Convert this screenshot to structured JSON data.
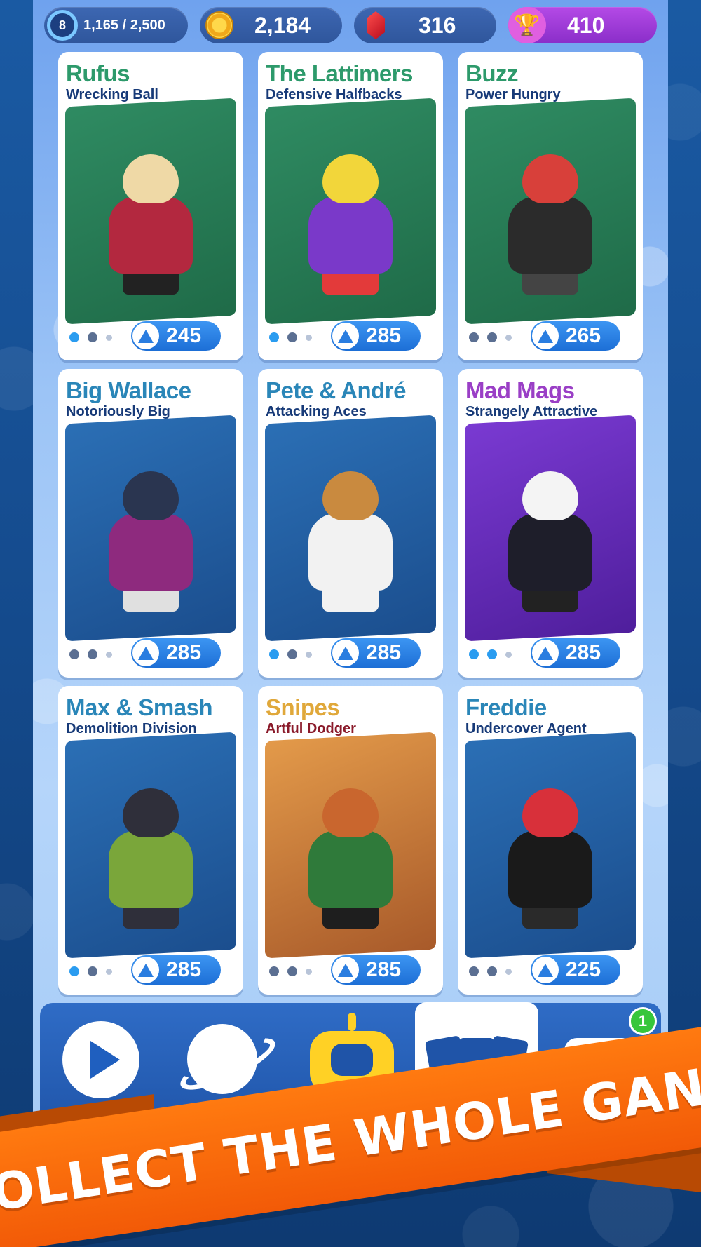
{
  "topbar": {
    "level": "8",
    "xp": "1,165 / 2,500",
    "coins": "2,184",
    "gems": "316",
    "trophies": "410",
    "icons": [
      "xp-ring-icon",
      "coin-icon",
      "gem-icon",
      "trophy-icon"
    ]
  },
  "cards": [
    {
      "name": "Rufus",
      "subtitle": "Wrecking Ball",
      "price": "245",
      "name_color": "#2d9a6b",
      "art_bg": [
        "#2f8b62",
        "#1f6b48"
      ],
      "body_color": "#b3283f",
      "head_color": "#efd9a6",
      "legs_color": "#222222",
      "dots": [
        true,
        false,
        false
      ]
    },
    {
      "name": "The Lattimers",
      "subtitle": "Defensive Halfbacks",
      "price": "285",
      "name_color": "#2d9a6b",
      "art_bg": [
        "#2f8b62",
        "#1f6b48"
      ],
      "body_color": "#7a39c9",
      "head_color": "#f2d63a",
      "legs_color": "#e33a3a",
      "dots": [
        true,
        false,
        false
      ]
    },
    {
      "name": "Buzz",
      "subtitle": "Power Hungry",
      "price": "265",
      "name_color": "#2d9a6b",
      "art_bg": [
        "#2f8b62",
        "#1f6b48"
      ],
      "body_color": "#2b2b2b",
      "head_color": "#d8403a",
      "legs_color": "#444444",
      "dots": [
        false,
        false,
        false
      ]
    },
    {
      "name": "Big Wallace",
      "subtitle": "Notoriously Big",
      "price": "285",
      "name_color": "#2a86b8",
      "art_bg": [
        "#2b6fb5",
        "#1b4e8e"
      ],
      "body_color": "#8e2a7e",
      "head_color": "#2a3550",
      "legs_color": "#e0e0e0",
      "dots": [
        false,
        false,
        false
      ]
    },
    {
      "name": "Pete & André",
      "subtitle": "Attacking Aces",
      "price": "285",
      "name_color": "#2a86b8",
      "art_bg": [
        "#2b6fb5",
        "#1b4e8e"
      ],
      "body_color": "#f2f2f2",
      "head_color": "#c98a3f",
      "legs_color": "#f2f2f2",
      "dots": [
        true,
        false,
        false
      ]
    },
    {
      "name": "Mad Mags",
      "subtitle": "Strangely Attractive",
      "price": "285",
      "name_color": "#9a3fc6",
      "art_bg": [
        "#7a3ad2",
        "#4f1e9c"
      ],
      "body_color": "#1e1e2a",
      "head_color": "#f4f4f4",
      "legs_color": "#222222",
      "dots": [
        true,
        true,
        false
      ]
    },
    {
      "name": "Max & Smash",
      "subtitle": "Demolition Division",
      "price": "285",
      "name_color": "#2a86b8",
      "art_bg": [
        "#2b6fb5",
        "#1b4e8e"
      ],
      "body_color": "#7aa63a",
      "head_color": "#2f2f3a",
      "legs_color": "#2f2f3a",
      "dots": [
        true,
        false,
        false
      ]
    },
    {
      "name": "Snipes",
      "subtitle": "Artful Dodger",
      "price": "285",
      "name_color": "#e0a83a",
      "art_bg": [
        "#e39a4a",
        "#a85a2a"
      ],
      "body_color": "#2f7a3a",
      "head_color": "#c9662e",
      "legs_color": "#1e1e1e",
      "dots": [
        false,
        false,
        false
      ]
    },
    {
      "name": "Freddie",
      "subtitle": "Undercover Agent",
      "price": "225",
      "name_color": "#2a86b8",
      "art_bg": [
        "#2b6fb5",
        "#1b4e8e"
      ],
      "body_color": "#1a1a1a",
      "head_color": "#d8303a",
      "legs_color": "#2a2a2a",
      "dots": [
        false,
        false,
        false
      ]
    }
  ],
  "subtitle_colors": {
    "default": "#173a78",
    "snipes": "#8a1a2a"
  },
  "nav": {
    "items": [
      "play-icon",
      "planet-icon",
      "robot-icon",
      "cards-icon",
      "chat-icon"
    ],
    "active": "cards-icon",
    "notification_count": "1"
  },
  "banner": {
    "text": "COLLECT THE WHOLE GANG"
  }
}
